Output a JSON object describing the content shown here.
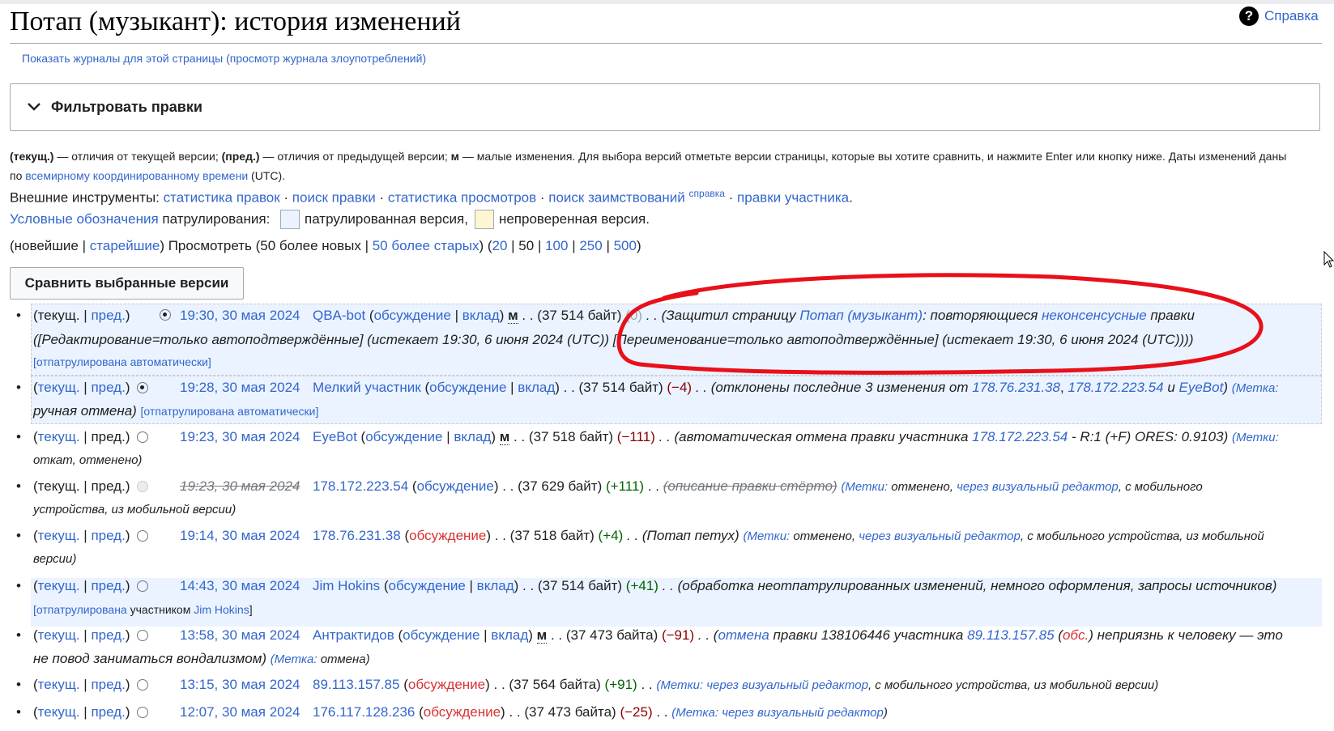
{
  "page": {
    "title": "Потап (музыкант): история изменений",
    "help_label": "Справка"
  },
  "sublinks": {
    "logs": "Показать журналы для этой страницы",
    "abuse": "(просмотр журнала злоупотреблений)"
  },
  "filter": {
    "label": "Фильтровать правки"
  },
  "legend": {
    "cur_b": "(текущ.)",
    "cur_t": " — отличия от текущей версии; ",
    "prev_b": "(пред.)",
    "prev_t": " — отличия от предыдущей версии; ",
    "m_b": "м",
    "m_t": " — малые изменения. Для выбора версий отметьте версии страницы, которые вы хотите сравнить, и нажмите Enter или кнопку ниже. Даты изменений даны по ",
    "utc_link": "всемирному координированному времени",
    "utc_t": " (UTC)."
  },
  "tools": {
    "label": "Внешние инструменты: ",
    "items": [
      "статистика правок",
      "поиск правки",
      "статистика просмотров",
      "поиск заимствований"
    ],
    "sup": "справка",
    "last": "правки участника",
    "sep": " · "
  },
  "patrol": {
    "link": "Условные обозначения",
    "t1": " патрулирования: ",
    "patrolled": "патрулированная версия,",
    "unchecked": "непроверенная версия.",
    "box1_color": "#eaf3ff",
    "box2_color": "#fef6d2"
  },
  "nav": {
    "newest": "(новейшие",
    "oldest": "старейшие",
    "view": ") Просмотреть (50 более новых | ",
    "older": "50 более старых",
    "paren": ") (",
    "n20": "20",
    "n50": "50",
    "n100": "100",
    "n250": "250",
    "n500": "500"
  },
  "compare_button": "Сравнить выбранные версии",
  "rows": [
    {
      "cur": "текущ.",
      "prev": "пред.",
      "date": "19:30, 30 мая 2024",
      "user": "QBA-bot",
      "talk": "обсуждение",
      "contrib": "вклад",
      "minor": "м",
      "size": ". . (37 514 байт)",
      "diff": "(0)",
      "sum1": ". . (Защитил страницу ",
      "sumlink": "Потап (музыкант)",
      "sum2": ": повторяющиеся ",
      "sumlink2": "неконсенсусные",
      "sum3": " правки",
      "line2": "([Редактирование=только автоподтверждённые] (истекает 19:30, 6 июня 2024 (UTC)) [Переименование=только автоподтверждённые] (истекает 19:30, 6 июня 2024 (UTC))))",
      "patrolled": "[отпатрулирована автоматически]"
    },
    {
      "cur": "текущ.",
      "prev": "пред.",
      "date": "19:28, 30 мая 2024",
      "user": "Мелкий участник",
      "talk": "обсуждение",
      "contrib": "вклад",
      "size": ". . (37 514 байт)",
      "diff": "(−4)",
      "sum1": ". . (отклонены последние 3 изменения от ",
      "ip1": "178.76.231.38",
      "ip2": "178.172.223.54",
      "and": " и ",
      "bot": "EyeBot",
      "sum2": ") ",
      "tags": "(Метка:",
      "line2": "ручная отмена)",
      "patrolled": "[отпатрулирована автоматически]"
    },
    {
      "cur": "текущ.",
      "prev": "пред.",
      "date": "19:23, 30 мая 2024",
      "user": "EyeBot",
      "talk": "обсуждение",
      "contrib": "вклад",
      "minor": "м",
      "size": ". . (37 518 байт)",
      "diff": "(−111)",
      "sum1": ". . (автоматическая отмена правки участника ",
      "ip": "178.172.223.54",
      "sum2": " - R:1 (+F) ORES: 0.9103)",
      "tags": "(Метки:",
      "line2": "откат, отменено)"
    },
    {
      "cur": "текущ.",
      "prev": "пред.",
      "date": "19:23, 30 мая 2024",
      "user": "178.172.223.54",
      "talk": "обсуждение",
      "size": ". . (37 629 байт)",
      "diff": "(+111)",
      "sum1": ". . ",
      "deleted": "(описание правки стёрто)",
      "tags": "(Метки:",
      "tag2": " отменено, ",
      "tag3": "через визуальный редактор",
      "tag4": ", с мобильного",
      "line2": "устройства, из мобильной версии)"
    },
    {
      "cur": "текущ.",
      "prev": "пред.",
      "date": "19:14, 30 мая 2024",
      "user": "178.76.231.38",
      "talk": "обсуждение",
      "size": ". . (37 518 байт)",
      "diff": "(+4)",
      "sum1": ". . (Потап петух)",
      "tags": "(Метки:",
      "tag2": " отменено, ",
      "tag3": "через визуальный редактор",
      "tag4": ", с мобильного устройства, из мобильной",
      "line2": "версии)"
    },
    {
      "cur": "текущ.",
      "prev": "пред.",
      "date": "14:43, 30 мая 2024",
      "user": "Jim Hokins",
      "talk": "обсуждение",
      "contrib": "вклад",
      "size": ". . (37 514 байт)",
      "diff": "(+41)",
      "sum1": ". . (обработка неотпатрулированных изменений, немного оформления, запросы источников)",
      "pat1": "[отпатрулирована",
      "pat2": " участником ",
      "pat3": "Jim Hokins",
      "pat4": "]"
    },
    {
      "cur": "текущ.",
      "prev": "пред.",
      "date": "13:58, 30 мая 2024",
      "user": "Антрактидов",
      "talk": "обсуждение",
      "contrib": "вклад",
      "minor": "м",
      "size": ". . (37 473 байта)",
      "diff": "(−91)",
      "sum0": ". . (",
      "undo": "отмена",
      "sum1": " правки 138106446 участника ",
      "ip": "89.113.157.85",
      "talklnk": "обс.",
      "sum2": ") неприязнь к человеку — это",
      "line2": "не повод заниматься вондализмом) ",
      "tags": "(Метка:",
      "tag2": " отмена)"
    },
    {
      "cur": "текущ.",
      "prev": "пред.",
      "date": "13:15, 30 мая 2024",
      "user": "89.113.157.85",
      "talk": "обсуждение",
      "size": ". . (37 564 байта)",
      "diff": "(+91)",
      "sum1": ". . ",
      "tags": "(Метки:",
      "tag3": " через визуальный редактор",
      "tag4": ", с мобильного устройства, из мобильной версии)"
    },
    {
      "cur": "текущ.",
      "prev": "пред.",
      "date": "12:07, 30 мая 2024",
      "user": "176.117.128.236",
      "talk": "обсуждение",
      "size": ". . (37 473 байта)",
      "diff": "(−25)",
      "sum1": ". . ",
      "tags": "(Метка:",
      "tag3": " через визуальный редактор",
      "tag4": ")"
    }
  ]
}
